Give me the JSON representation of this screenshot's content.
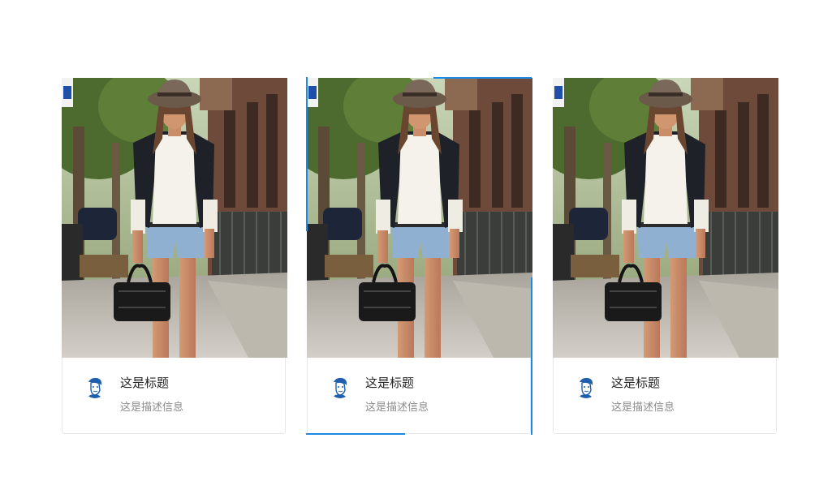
{
  "cards": [
    {
      "title": "这是标题",
      "description": "这是描述信息",
      "image": "street-fashion-photo",
      "avatar": "avatar-icon",
      "highlighted": false
    },
    {
      "title": "这是标题",
      "description": "这是描述信息",
      "image": "street-fashion-photo",
      "avatar": "avatar-icon",
      "highlighted": true
    },
    {
      "title": "这是标题",
      "description": "这是描述信息",
      "image": "street-fashion-photo",
      "avatar": "avatar-icon",
      "highlighted": false
    }
  ],
  "colors": {
    "highlight_border": "#1e88e5",
    "card_border": "#e8e8e8",
    "title_text": "#262626",
    "description_text": "#8c8c8c"
  }
}
